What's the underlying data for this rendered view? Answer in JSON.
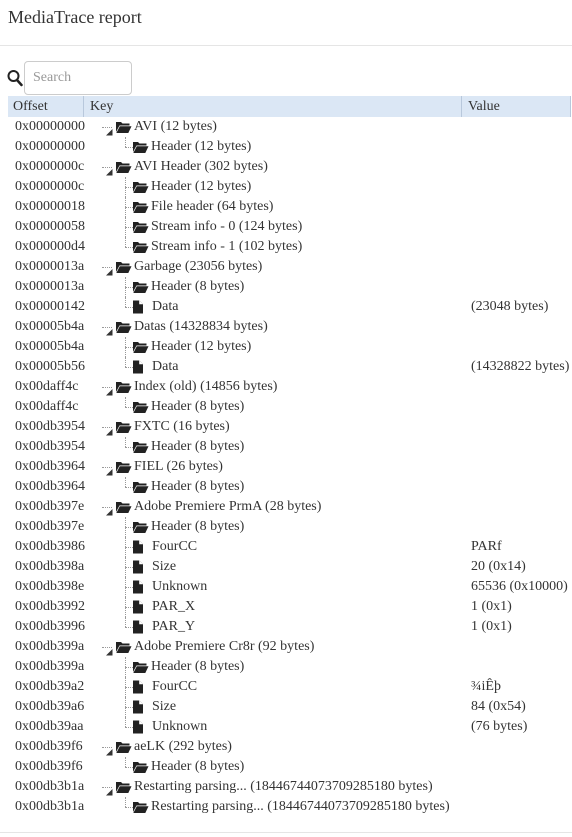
{
  "app": {
    "title": "MediaTrace report"
  },
  "search": {
    "placeholder": "Search"
  },
  "columns": {
    "offset": "Offset",
    "key": "Key",
    "value": "Value"
  },
  "rows": [
    {
      "offset": "0x00000000",
      "key": "AVI (12 bytes)",
      "value": "",
      "level": 0,
      "kind": "folder",
      "expanded": true
    },
    {
      "offset": "0x00000000",
      "key": "Header (12 bytes)",
      "value": "",
      "level": 1,
      "kind": "folder"
    },
    {
      "offset": "0x0000000c",
      "key": "AVI Header (302 bytes)",
      "value": "",
      "level": 0,
      "kind": "folder",
      "expanded": true
    },
    {
      "offset": "0x0000000c",
      "key": "Header (12 bytes)",
      "value": "",
      "level": 1,
      "kind": "folder"
    },
    {
      "offset": "0x00000018",
      "key": "File header (64 bytes)",
      "value": "",
      "level": 1,
      "kind": "folder"
    },
    {
      "offset": "0x00000058",
      "key": "Stream info - 0 (124 bytes)",
      "value": "",
      "level": 1,
      "kind": "folder"
    },
    {
      "offset": "0x000000d4",
      "key": "Stream info - 1 (102 bytes)",
      "value": "",
      "level": 1,
      "kind": "folder"
    },
    {
      "offset": "0x0000013a",
      "key": "Garbage (23056 bytes)",
      "value": "",
      "level": 0,
      "kind": "folder",
      "expanded": true
    },
    {
      "offset": "0x0000013a",
      "key": "Header (8 bytes)",
      "value": "",
      "level": 1,
      "kind": "folder"
    },
    {
      "offset": "0x00000142",
      "key": "Data",
      "value": "(23048 bytes)",
      "level": 1,
      "kind": "file"
    },
    {
      "offset": "0x00005b4a",
      "key": "Datas (14328834 bytes)",
      "value": "",
      "level": 0,
      "kind": "folder",
      "expanded": true
    },
    {
      "offset": "0x00005b4a",
      "key": "Header (12 bytes)",
      "value": "",
      "level": 1,
      "kind": "folder"
    },
    {
      "offset": "0x00005b56",
      "key": "Data",
      "value": "(14328822 bytes)",
      "level": 1,
      "kind": "file"
    },
    {
      "offset": "0x00daff4c",
      "key": "Index (old) (14856 bytes)",
      "value": "",
      "level": 0,
      "kind": "folder",
      "expanded": true
    },
    {
      "offset": "0x00daff4c",
      "key": "Header (8 bytes)",
      "value": "",
      "level": 1,
      "kind": "folder"
    },
    {
      "offset": "0x00db3954",
      "key": "FXTC (16 bytes)",
      "value": "",
      "level": 0,
      "kind": "folder",
      "expanded": true
    },
    {
      "offset": "0x00db3954",
      "key": "Header (8 bytes)",
      "value": "",
      "level": 1,
      "kind": "folder"
    },
    {
      "offset": "0x00db3964",
      "key": "FIEL (26 bytes)",
      "value": "",
      "level": 0,
      "kind": "folder",
      "expanded": true
    },
    {
      "offset": "0x00db3964",
      "key": "Header (8 bytes)",
      "value": "",
      "level": 1,
      "kind": "folder"
    },
    {
      "offset": "0x00db397e",
      "key": "Adobe Premiere PrmA (28 bytes)",
      "value": "",
      "level": 0,
      "kind": "folder",
      "expanded": true
    },
    {
      "offset": "0x00db397e",
      "key": "Header (8 bytes)",
      "value": "",
      "level": 1,
      "kind": "folder"
    },
    {
      "offset": "0x00db3986",
      "key": "FourCC",
      "value": "PARf",
      "level": 1,
      "kind": "file"
    },
    {
      "offset": "0x00db398a",
      "key": "Size",
      "value": "20 (0x14)",
      "level": 1,
      "kind": "file"
    },
    {
      "offset": "0x00db398e",
      "key": "Unknown",
      "value": "65536 (0x10000)",
      "level": 1,
      "kind": "file"
    },
    {
      "offset": "0x00db3992",
      "key": "PAR_X",
      "value": "1 (0x1)",
      "level": 1,
      "kind": "file"
    },
    {
      "offset": "0x00db3996",
      "key": "PAR_Y",
      "value": "1 (0x1)",
      "level": 1,
      "kind": "file"
    },
    {
      "offset": "0x00db399a",
      "key": "Adobe Premiere Cr8r (92 bytes)",
      "value": "",
      "level": 0,
      "kind": "folder",
      "expanded": true
    },
    {
      "offset": "0x00db399a",
      "key": "Header (8 bytes)",
      "value": "",
      "level": 1,
      "kind": "folder"
    },
    {
      "offset": "0x00db39a2",
      "key": "FourCC",
      "value": "¾iÊþ",
      "level": 1,
      "kind": "file"
    },
    {
      "offset": "0x00db39a6",
      "key": "Size",
      "value": "84 (0x54)",
      "level": 1,
      "kind": "file"
    },
    {
      "offset": "0x00db39aa",
      "key": "Unknown",
      "value": "(76 bytes)",
      "level": 1,
      "kind": "file"
    },
    {
      "offset": "0x00db39f6",
      "key": "aeLK (292 bytes)",
      "value": "",
      "level": 0,
      "kind": "folder",
      "expanded": true
    },
    {
      "offset": "0x00db39f6",
      "key": "Header (8 bytes)",
      "value": "",
      "level": 1,
      "kind": "folder"
    },
    {
      "offset": "0x00db3b1a",
      "key": "Restarting parsing... (18446744073709285180 bytes)",
      "value": "",
      "level": 0,
      "kind": "folder",
      "expanded": true
    },
    {
      "offset": "0x00db3b1a",
      "key": "Restarting parsing... (18446744073709285180 bytes)",
      "value": "",
      "level": 1,
      "kind": "folder"
    }
  ]
}
